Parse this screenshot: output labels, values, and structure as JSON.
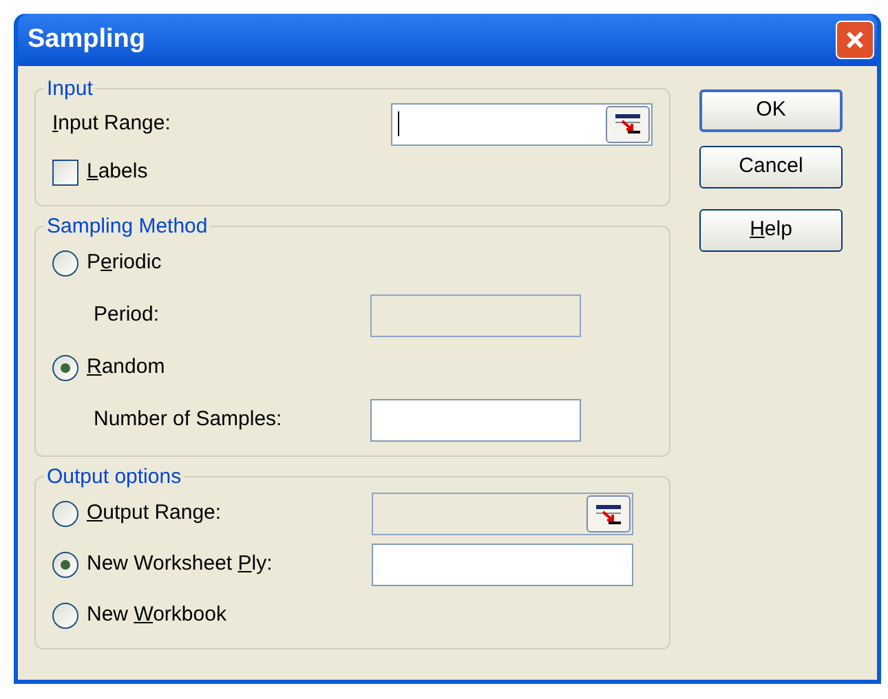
{
  "window": {
    "title": "Sampling"
  },
  "groups": [
    {
      "title": "Input",
      "rows": [
        {
          "kind": "field",
          "label": [
            {
              "text": "I",
              "underline": true
            },
            {
              "text": "nput Range:",
              "underline": false
            }
          ],
          "field": {
            "disabled": false,
            "focused": true,
            "ref_button": true
          }
        },
        {
          "kind": "checkbox",
          "checked": false,
          "label": [
            {
              "text": "L",
              "underline": true
            },
            {
              "text": "abels",
              "underline": false
            }
          ]
        }
      ]
    },
    {
      "title": "Sampling Method",
      "rows": [
        {
          "kind": "radio",
          "selected": false,
          "label": [
            {
              "text": "P",
              "underline": false
            },
            {
              "text": "e",
              "underline": true
            },
            {
              "text": "riodic",
              "underline": false
            }
          ]
        },
        {
          "kind": "subfield",
          "label": [
            {
              "text": "Period:",
              "underline": false
            }
          ],
          "field": {
            "disabled": true,
            "focused": false,
            "ref_button": false
          }
        },
        {
          "kind": "radio",
          "selected": true,
          "label": [
            {
              "text": "R",
              "underline": true
            },
            {
              "text": "andom",
              "underline": false
            }
          ]
        },
        {
          "kind": "subfield",
          "label": [
            {
              "text": "Number of Samples:",
              "underline": false
            }
          ],
          "field": {
            "disabled": false,
            "focused": false,
            "ref_button": false
          }
        }
      ]
    },
    {
      "title": "Output options",
      "rows": [
        {
          "kind": "radio-field",
          "selected": false,
          "label": [
            {
              "text": "O",
              "underline": true
            },
            {
              "text": "utput Range:",
              "underline": false
            }
          ],
          "field": {
            "disabled": true,
            "focused": false,
            "ref_button": true
          }
        },
        {
          "kind": "radio-field",
          "selected": true,
          "label": [
            {
              "text": "New Worksheet ",
              "underline": false
            },
            {
              "text": "P",
              "underline": true
            },
            {
              "text": "ly:",
              "underline": false
            }
          ],
          "field": {
            "disabled": false,
            "focused": false,
            "ref_button": false
          }
        },
        {
          "kind": "radio",
          "selected": false,
          "label": [
            {
              "text": "New ",
              "underline": false
            },
            {
              "text": "W",
              "underline": true
            },
            {
              "text": "orkbook",
              "underline": false
            }
          ]
        }
      ]
    }
  ],
  "buttons": [
    {
      "label": [
        {
          "text": "OK",
          "underline": false
        }
      ],
      "default": true
    },
    {
      "label": [
        {
          "text": "Cancel",
          "underline": false
        }
      ],
      "default": false
    },
    {
      "label": [
        {
          "text": "H",
          "underline": true
        },
        {
          "text": "elp",
          "underline": false
        }
      ],
      "default": false
    }
  ]
}
